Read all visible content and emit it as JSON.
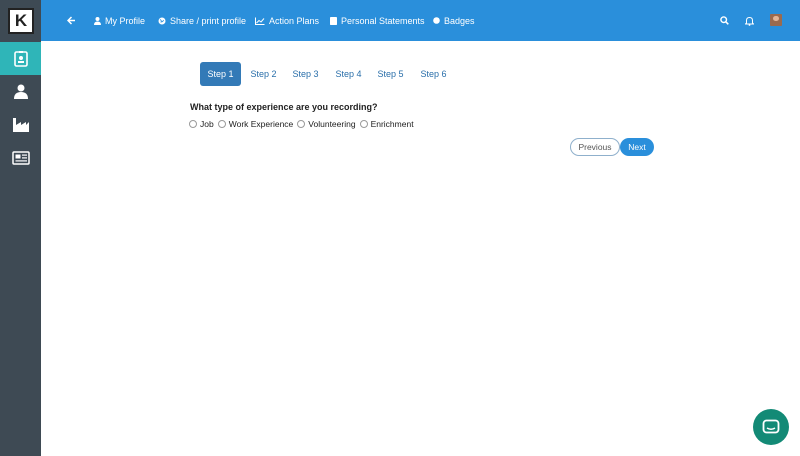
{
  "nav": {
    "items": [
      {
        "label": "My Profile",
        "icon": "user-icon"
      },
      {
        "label": "Share / print profile",
        "icon": "globe-icon"
      },
      {
        "label": "Action Plans",
        "icon": "chart-line-icon"
      },
      {
        "label": "Personal Statements",
        "icon": "document-icon"
      },
      {
        "label": "Badges",
        "icon": "badge-icon"
      }
    ]
  },
  "logo": {
    "text": "K"
  },
  "steps": [
    "Step 1",
    "Step 2",
    "Step 3",
    "Step 4",
    "Step 5",
    "Step 6"
  ],
  "active_step": "Step 1",
  "form": {
    "question": "What type of experience are you recording?",
    "options": [
      "Job",
      "Work Experience",
      "Volunteering",
      "Enrichment"
    ]
  },
  "buttons": {
    "previous": "Previous",
    "next": "Next"
  },
  "colors": {
    "topbar": "#2a8fdb",
    "sidebar": "#3e4a54",
    "sidebar_active": "#2fb5b8",
    "step_active": "#337ab7",
    "chat": "#138a76"
  }
}
